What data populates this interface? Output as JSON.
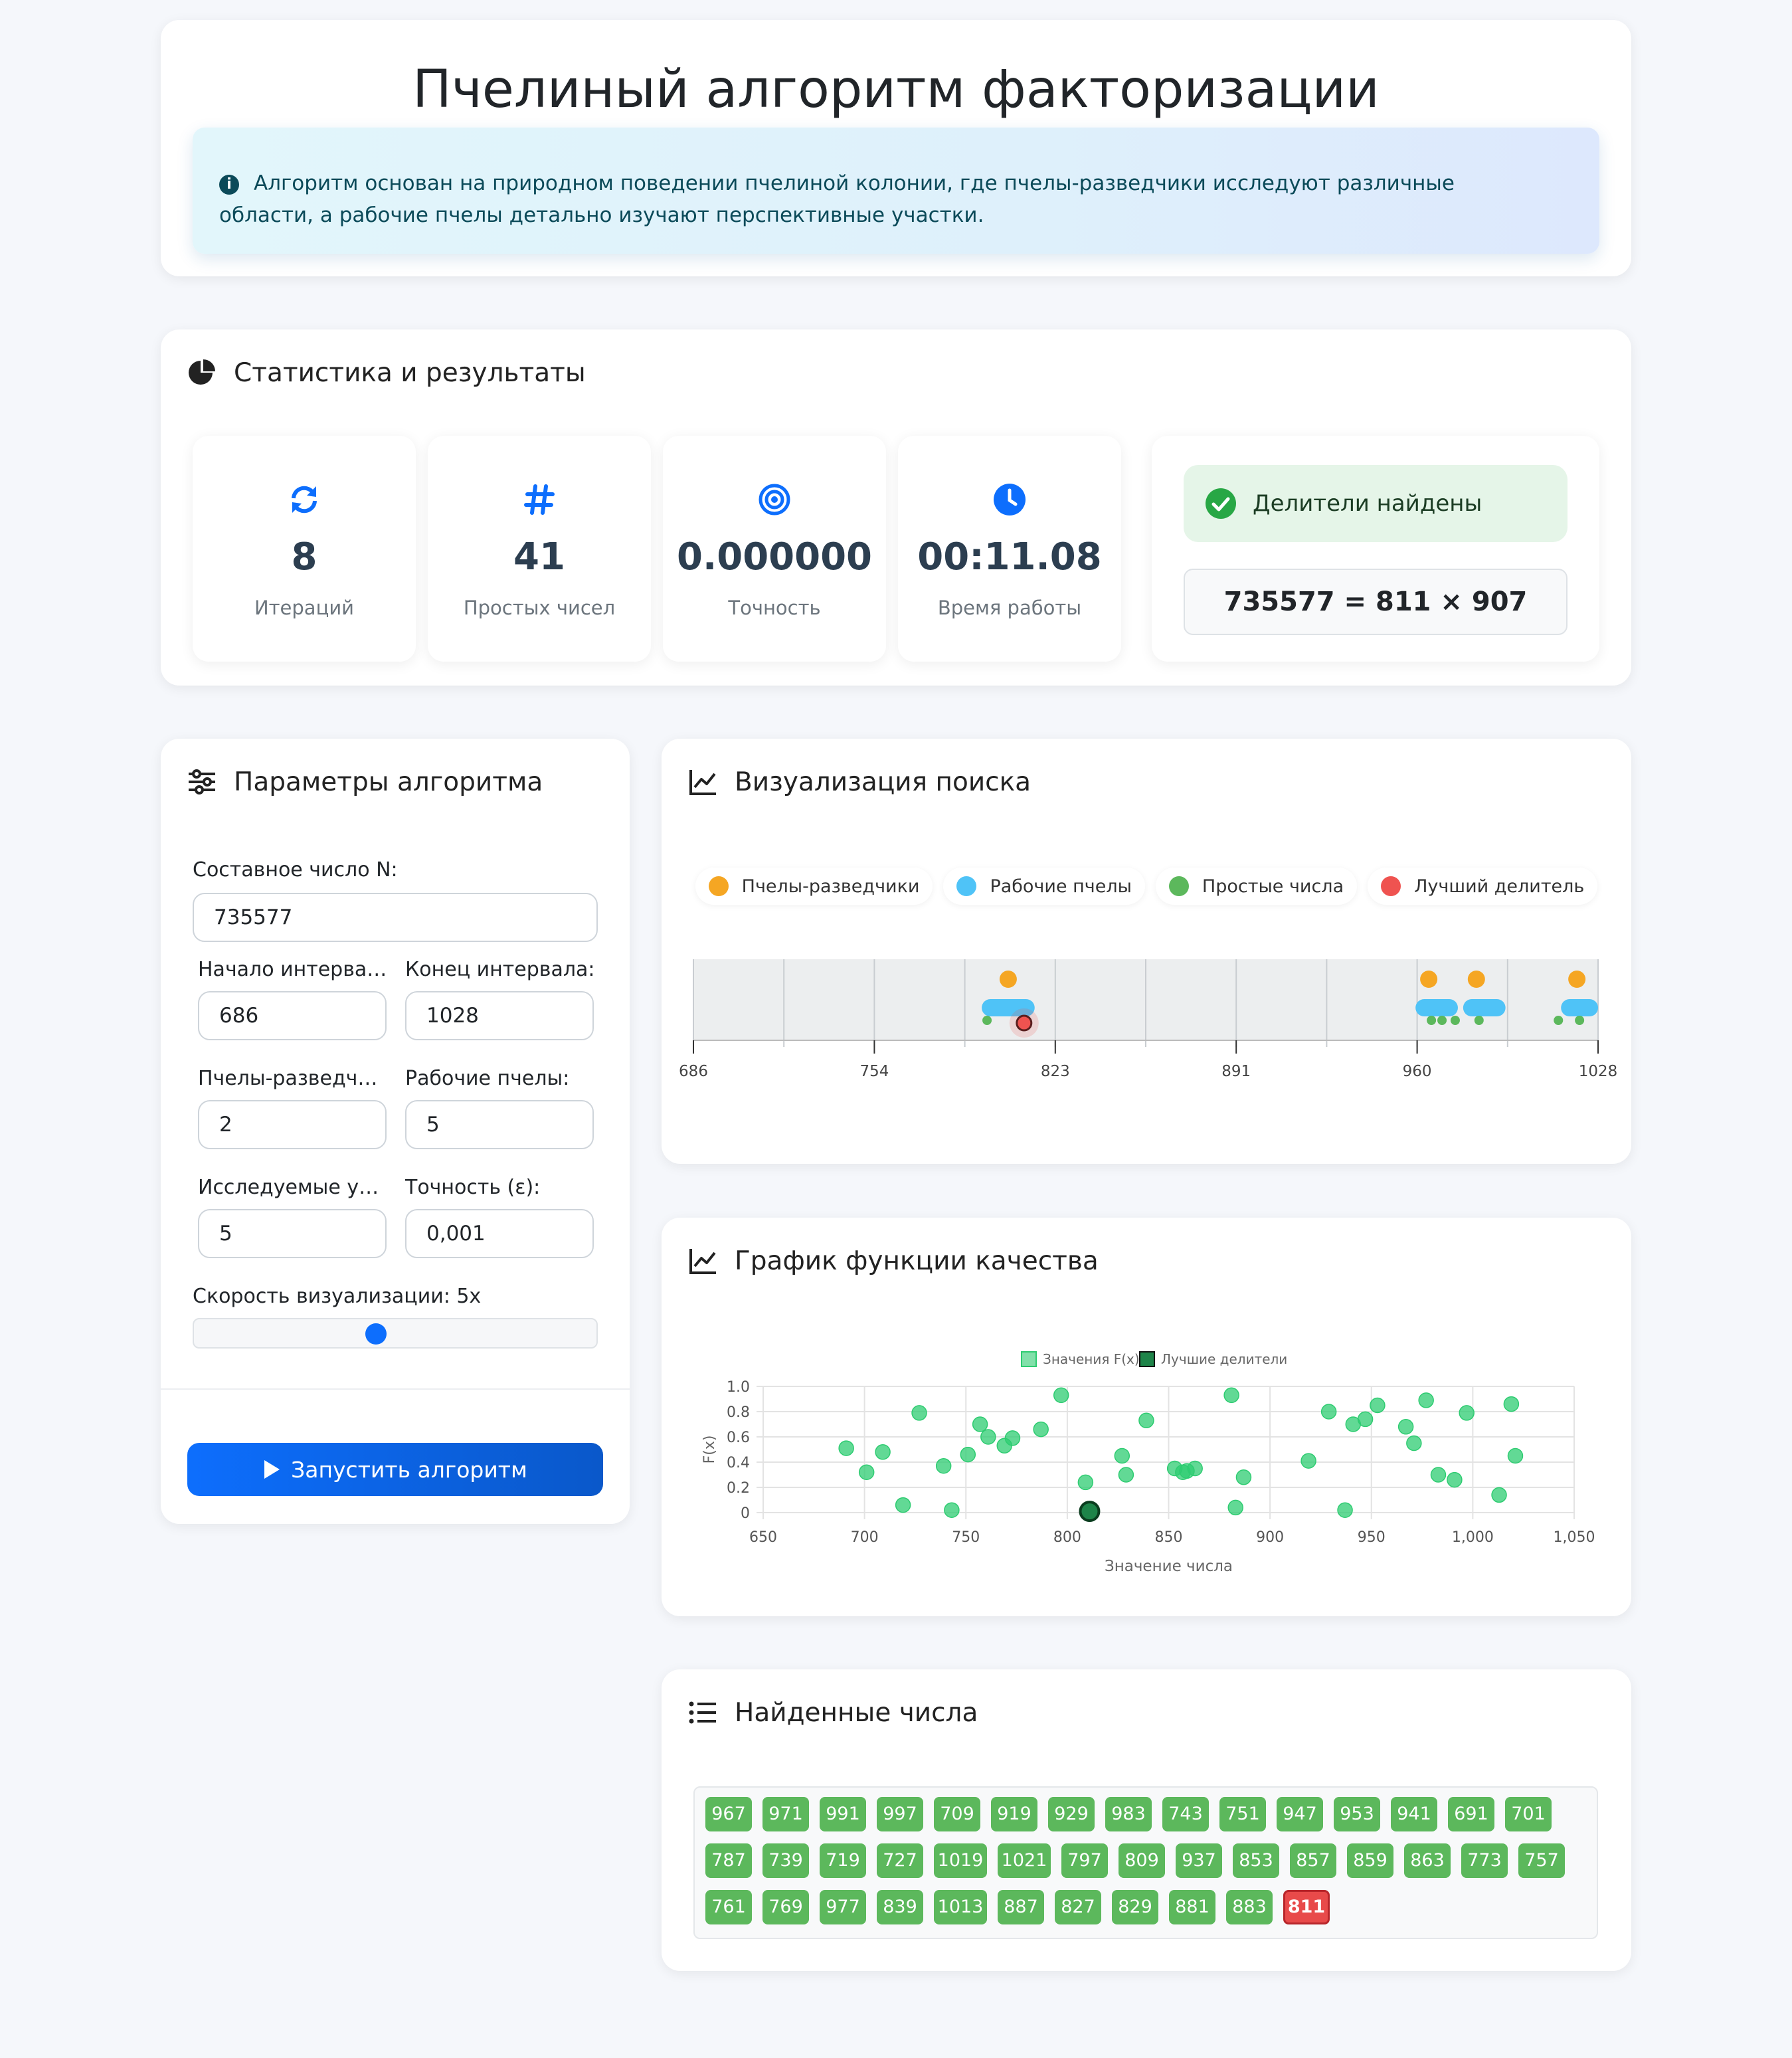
{
  "header": {
    "title": "Пчелиный алгоритм факторизации",
    "info": "Алгоритм основан на природном поведении пчелиной колонии, где пчелы-разведчики исследуют различные области, а рабочие пчелы детально изучают перспективные участки."
  },
  "stats": {
    "title": "Статистика и результаты",
    "items": [
      {
        "value": "8",
        "label": "Итераций",
        "icon": "refresh-icon"
      },
      {
        "value": "41",
        "label": "Простых чисел",
        "icon": "hash-icon"
      },
      {
        "value": "0.000000",
        "label": "Точность",
        "icon": "target-icon"
      },
      {
        "value": "00:11.08",
        "label": "Время работы",
        "icon": "clock-icon"
      }
    ],
    "result_status": "Делители найдены",
    "result_equation": "735577 = 811 × 907"
  },
  "params": {
    "title": "Параметры алгоритма",
    "n_label": "Составное число N:",
    "n_value": "735577",
    "start_label": "Начало интервала:",
    "start_value": "686",
    "end_label": "Конец интервала:",
    "end_value": "1028",
    "scouts_label": "Пчелы-разведчики:",
    "scouts_value": "2",
    "workers_label": "Рабочие пчелы:",
    "workers_value": "5",
    "sites_label": "Исследуемые участки:",
    "sites_value": "5",
    "eps_label": "Точность (ε):",
    "eps_value": "0,001",
    "speed_label": "Скорость визуализации: 5x",
    "speed_level": 0.45,
    "run_label": "Запустить алгоритм"
  },
  "viz": {
    "title": "Визуализация поиска",
    "legend": [
      {
        "label": "Пчелы-разведчики",
        "color": "#f5a623"
      },
      {
        "label": "Рабочие пчелы",
        "color": "#4fc3f7"
      },
      {
        "label": "Простые числа",
        "color": "#5cb85c"
      },
      {
        "label": "Лучший делитель",
        "color": "#ef5350"
      }
    ],
    "ticks": [
      "686",
      "754",
      "823",
      "891",
      "960",
      "1028"
    ],
    "range": [
      686,
      1028
    ],
    "scouts": [
      805,
      964,
      982,
      1020
    ],
    "workers": [
      {
        "from": 797,
        "to": 813
      },
      {
        "from": 961,
        "to": 973
      },
      {
        "from": 979,
        "to": 991
      },
      {
        "from": 1016,
        "to": 1026
      }
    ],
    "primes": [
      797,
      965,
      969,
      974,
      983,
      1013,
      1021
    ],
    "best": 811
  },
  "chart_data": {
    "type": "scatter",
    "title": "График функции качества",
    "xlabel": "Значение числа",
    "ylabel": "F(x)",
    "xlim": [
      650,
      1050
    ],
    "ylim": [
      0,
      1
    ],
    "xticks": [
      "650",
      "700",
      "750",
      "800",
      "850",
      "900",
      "950",
      "1,000",
      "1,050"
    ],
    "yticks": [
      "0",
      "0.2",
      "0.4",
      "0.6",
      "0.8",
      "1.0"
    ],
    "grid": true,
    "legend_position": "top",
    "series": [
      {
        "name": "Значения F(x)",
        "color": "#2ecc71",
        "points": [
          [
            691,
            0.51
          ],
          [
            701,
            0.32
          ],
          [
            709,
            0.48
          ],
          [
            719,
            0.06
          ],
          [
            727,
            0.79
          ],
          [
            739,
            0.37
          ],
          [
            743,
            0.02
          ],
          [
            751,
            0.46
          ],
          [
            757,
            0.7
          ],
          [
            761,
            0.6
          ],
          [
            769,
            0.53
          ],
          [
            773,
            0.59
          ],
          [
            787,
            0.66
          ],
          [
            797,
            0.93
          ],
          [
            809,
            0.24
          ],
          [
            827,
            0.45
          ],
          [
            829,
            0.3
          ],
          [
            839,
            0.73
          ],
          [
            853,
            0.35
          ],
          [
            857,
            0.32
          ],
          [
            859,
            0.33
          ],
          [
            863,
            0.35
          ],
          [
            881,
            0.93
          ],
          [
            883,
            0.04
          ],
          [
            887,
            0.28
          ],
          [
            919,
            0.41
          ],
          [
            929,
            0.8
          ],
          [
            937,
            0.02
          ],
          [
            941,
            0.7
          ],
          [
            947,
            0.74
          ],
          [
            953,
            0.85
          ],
          [
            967,
            0.68
          ],
          [
            971,
            0.55
          ],
          [
            977,
            0.89
          ],
          [
            983,
            0.3
          ],
          [
            991,
            0.26
          ],
          [
            997,
            0.79
          ],
          [
            1013,
            0.14
          ],
          [
            1019,
            0.86
          ],
          [
            1021,
            0.45
          ]
        ]
      },
      {
        "name": "Лучшие делители",
        "color": "#1e8449",
        "points": [
          [
            811,
            0.01
          ]
        ]
      }
    ]
  },
  "found": {
    "title": "Найденные числа",
    "numbers": [
      "967",
      "971",
      "991",
      "997",
      "709",
      "919",
      "929",
      "983",
      "743",
      "751",
      "947",
      "953",
      "941",
      "691",
      "701",
      "787",
      "739",
      "719",
      "727",
      "1019",
      "1021",
      "797",
      "809",
      "937",
      "853",
      "857",
      "859",
      "863",
      "773",
      "757",
      "761",
      "769",
      "977",
      "839",
      "1013",
      "887",
      "827",
      "829",
      "881",
      "883"
    ],
    "best": "811"
  },
  "colors": {
    "primary": "#0d6efd",
    "success": "#28a745",
    "prime": "#5cb85c",
    "best": "#e84a4a",
    "scout": "#f5a623",
    "worker": "#4fc3f7"
  }
}
